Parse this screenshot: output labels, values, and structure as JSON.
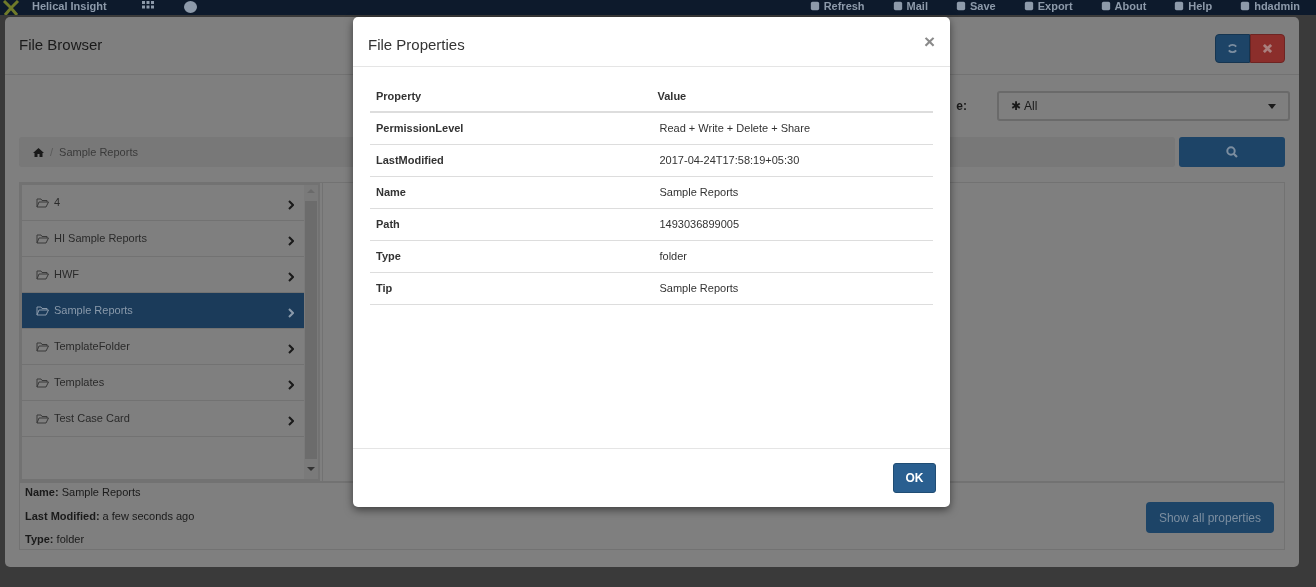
{
  "navbar": {
    "brand": "Helical Insight",
    "items": [
      "Refresh",
      "Mail",
      "Save",
      "Export",
      "About",
      "Help",
      "hdadmin"
    ]
  },
  "file_browser": {
    "title": "File Browser",
    "filter_label": "e:",
    "filter_icon": "✱",
    "filter_value": "All",
    "breadcrumb_separator": "/",
    "breadcrumb": [
      "Sample Reports"
    ],
    "folders": [
      {
        "name": "4",
        "selected": false
      },
      {
        "name": "HI Sample Reports",
        "selected": false
      },
      {
        "name": "HWF",
        "selected": false
      },
      {
        "name": "Sample Reports",
        "selected": true
      },
      {
        "name": "TemplateFolder",
        "selected": false
      },
      {
        "name": "Templates",
        "selected": false
      },
      {
        "name": "Test Case Card",
        "selected": false
      }
    ],
    "details": [
      "**Name:** Sample Reports",
      "**Last Modified:** a few seconds ago",
      "**Type:** folder"
    ],
    "show_all_button": "Show all properties"
  },
  "dialog": {
    "title": "File Properties",
    "close": "×",
    "columns": [
      "Property",
      "Value"
    ],
    "rows": [
      [
        "PermissionLevel",
        "Read + Write + Delete + Share"
      ],
      [
        "LastModified",
        "2017-04-24T17:58:19+05:30"
      ],
      [
        "Name",
        "Sample Reports"
      ],
      [
        "Path",
        "1493036899005"
      ],
      [
        "Type",
        "folder"
      ],
      [
        "Tip",
        "Sample Reports"
      ]
    ],
    "ok_button": "OK"
  }
}
